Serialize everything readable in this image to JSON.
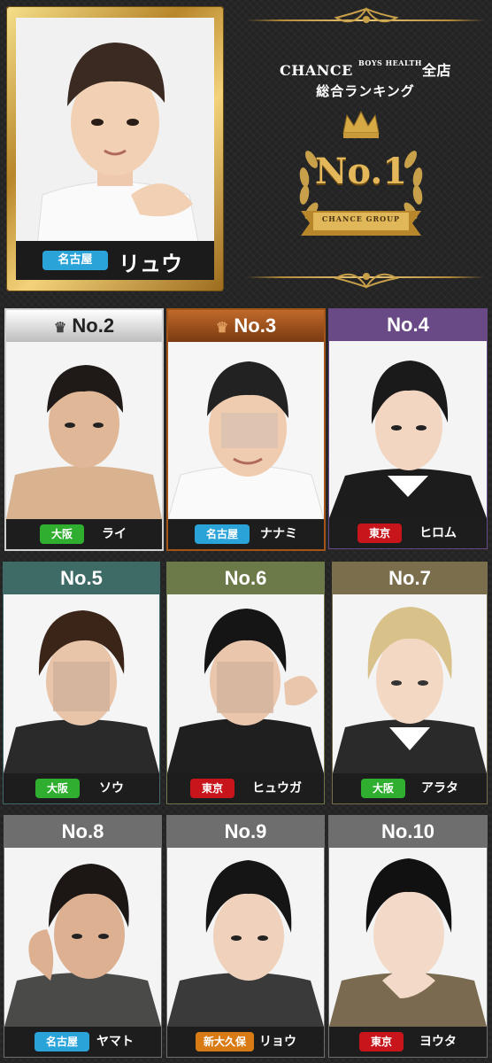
{
  "featured": {
    "region": "名古屋",
    "name": "リュウ"
  },
  "emblem": {
    "brand": "CHANCE",
    "brand_small": "BOYS HEALTH",
    "store_scope": "全店",
    "title": "総合ランキング",
    "rank": "No.1",
    "ribbon": "CHANCE GROUP"
  },
  "cards": [
    {
      "rank": "No.2",
      "region": "大阪",
      "name": "ライ"
    },
    {
      "rank": "No.3",
      "region": "名古屋",
      "name": "ナナミ"
    },
    {
      "rank": "No.4",
      "region": "東京",
      "name": "ヒロム"
    },
    {
      "rank": "No.5",
      "region": "大阪",
      "name": "ソウ"
    },
    {
      "rank": "No.6",
      "region": "東京",
      "name": "ヒュウガ"
    },
    {
      "rank": "No.7",
      "region": "大阪",
      "name": "アラタ"
    },
    {
      "rank": "No.8",
      "region": "名古屋",
      "name": "ヤマト"
    },
    {
      "rank": "No.9",
      "region": "新大久保",
      "name": "リョウ"
    },
    {
      "rank": "No.10",
      "region": "東京",
      "name": "ヨウタ"
    }
  ],
  "colors": {
    "gold": "#c9a04a",
    "region_osaka": "#2fae2f",
    "region_nagoya": "#2aa3d9",
    "region_tokyo": "#c8151b",
    "region_shinokubo": "#d97b14",
    "head_no4": "#6a4a86",
    "head_no5": "#3f6b66",
    "head_no6": "#6c7a4a",
    "head_no7": "#7b6e4c",
    "head_row4": "#6e6e6e"
  }
}
